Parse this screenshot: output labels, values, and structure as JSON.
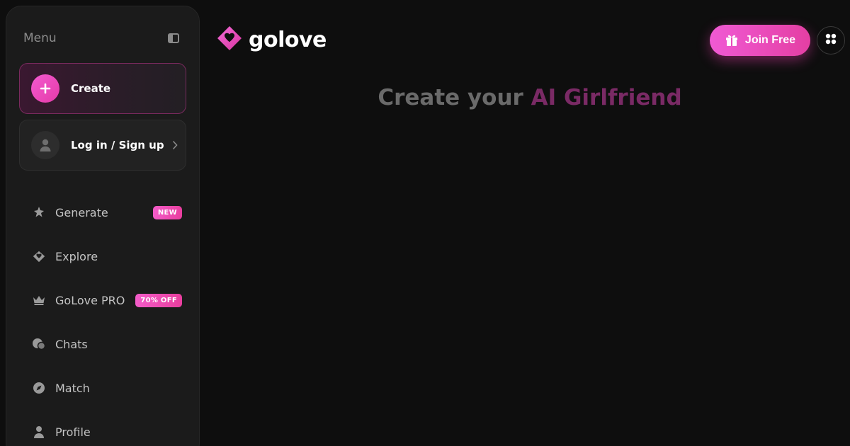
{
  "sidebar": {
    "menu_title": "Menu",
    "create_label": "Create",
    "login_label": "Log in / Sign up",
    "items": [
      {
        "label": "Generate",
        "badge": "NEW",
        "icon": "sparkle-icon"
      },
      {
        "label": "Explore",
        "badge": "",
        "icon": "heart-diamond-icon"
      },
      {
        "label": "GoLove PRO",
        "badge": "70% OFF",
        "icon": "crown-icon"
      },
      {
        "label": "Chats",
        "badge": "",
        "icon": "chat-bubbles-icon"
      },
      {
        "label": "Match",
        "badge": "",
        "icon": "compass-icon"
      },
      {
        "label": "Profile",
        "badge": "",
        "icon": "user-icon"
      }
    ]
  },
  "header": {
    "logo_text": "golove",
    "join_label": "Join Free"
  },
  "main": {
    "headline_prefix": "Create your ",
    "headline_accent": "AI Girlfriend"
  },
  "colors": {
    "accent": "#e94aba",
    "background": "#0e0e0e",
    "sidebar": "#1b1b1b"
  }
}
